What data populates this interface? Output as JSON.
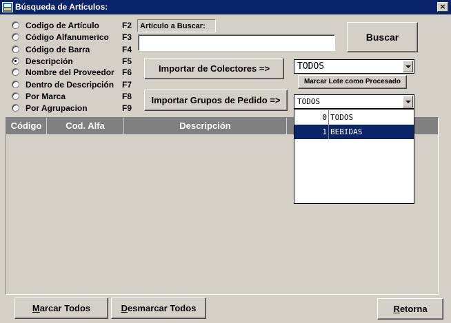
{
  "window": {
    "title": "Búsqueda de Artículos:",
    "close_label": "×"
  },
  "search_options": [
    {
      "label": "Codigo de Artículo",
      "key": "F2",
      "checked": false
    },
    {
      "label": "Código Alfanumerico",
      "key": "F3",
      "checked": false
    },
    {
      "label": "Código de Barra",
      "key": "F4",
      "checked": false
    },
    {
      "label": "Descripción",
      "key": "F5",
      "checked": true
    },
    {
      "label": "Nombre del Proveedor",
      "key": "F6",
      "checked": false
    },
    {
      "label": "Dentro de Descripción",
      "key": "F7",
      "checked": false
    },
    {
      "label": "Por Marca",
      "key": "F8",
      "checked": false
    },
    {
      "label": "Por Agrupacion",
      "key": "F9",
      "checked": false
    }
  ],
  "search": {
    "label": "Artículo a Buscar:",
    "value": "",
    "button": "Buscar"
  },
  "importar_colectores": {
    "button": "Importar de Colectores =>",
    "combo_value": "TODOS",
    "marcar_lote": "Marcar Lote como Procesado"
  },
  "importar_grupos": {
    "button": "Importar Grupos de Pedido =>",
    "combo_value": "TODOS",
    "options": [
      {
        "code": "0",
        "label": "TODOS",
        "selected": false
      },
      {
        "code": "1",
        "label": "BEBIDAS",
        "selected": true
      }
    ]
  },
  "grid": {
    "columns": [
      "Código",
      "Cod. Alfa",
      "Descripción"
    ]
  },
  "footer": {
    "marcar_todos_ul": "M",
    "marcar_todos_rest": "arcar Todos",
    "desmarcar_todos_ul": "D",
    "desmarcar_todos_rest": "esmarcar Todos",
    "retorna_ul": "R",
    "retorna_rest": "etorna"
  }
}
